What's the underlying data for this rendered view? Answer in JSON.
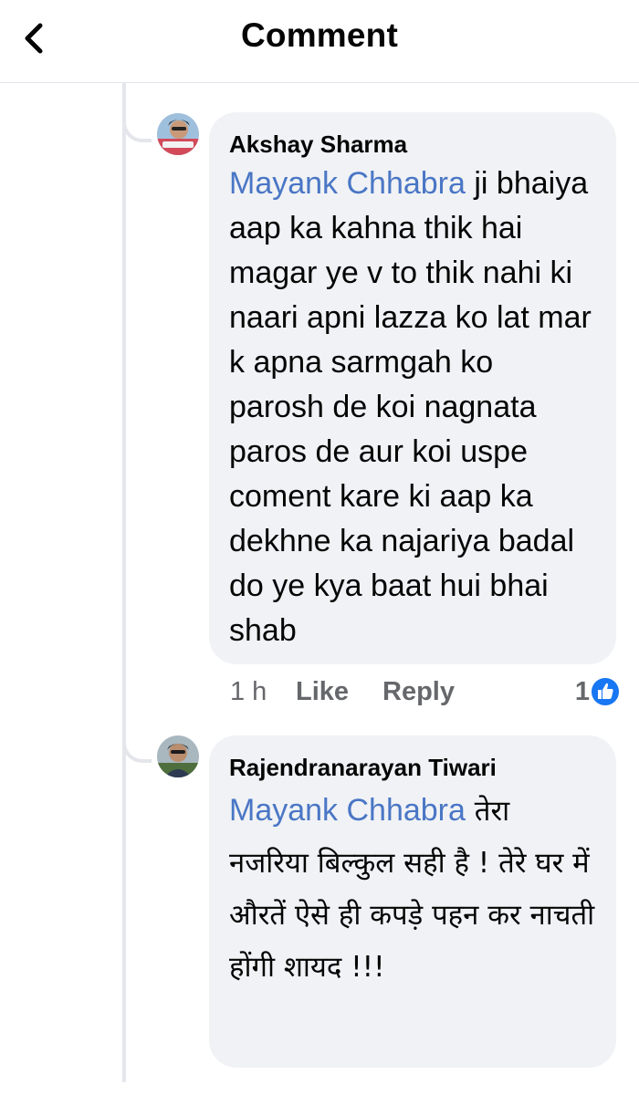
{
  "header": {
    "title": "Comment",
    "back_icon": "chevron-left-icon"
  },
  "comments": [
    {
      "author": "Akshay Sharma",
      "mention": "Mayank Chhabra",
      "text": " ji bhaiya aap ka kahna thik hai magar ye v to thik nahi ki naari apni lazza ko lat mar k apna sarmgah ko parosh de koi nagnata paros de aur koi uspe coment kare ki aap ka dekhne ka najariya badal do ye kya baat hui bhai shab",
      "time": "1 h",
      "like_label": "Like",
      "reply_label": "Reply",
      "like_count": "1",
      "reaction_icon": "thumbs-up-icon",
      "avatar_icon": "avatar"
    },
    {
      "author": "Rajendranarayan Tiwari",
      "mention": "Mayank Chhabra",
      "text": " तेरा नजरिया बिल्कुल सही है ! तेरे घर में औरतें ऐसे ही कपड़े पहन कर नाचती होंगी शायद !!!",
      "avatar_icon": "avatar"
    }
  ],
  "colors": {
    "bubble": "#f0f2f5",
    "mention": "#4a76c5",
    "meta": "#65676b",
    "like_blue": "#1877f2"
  }
}
